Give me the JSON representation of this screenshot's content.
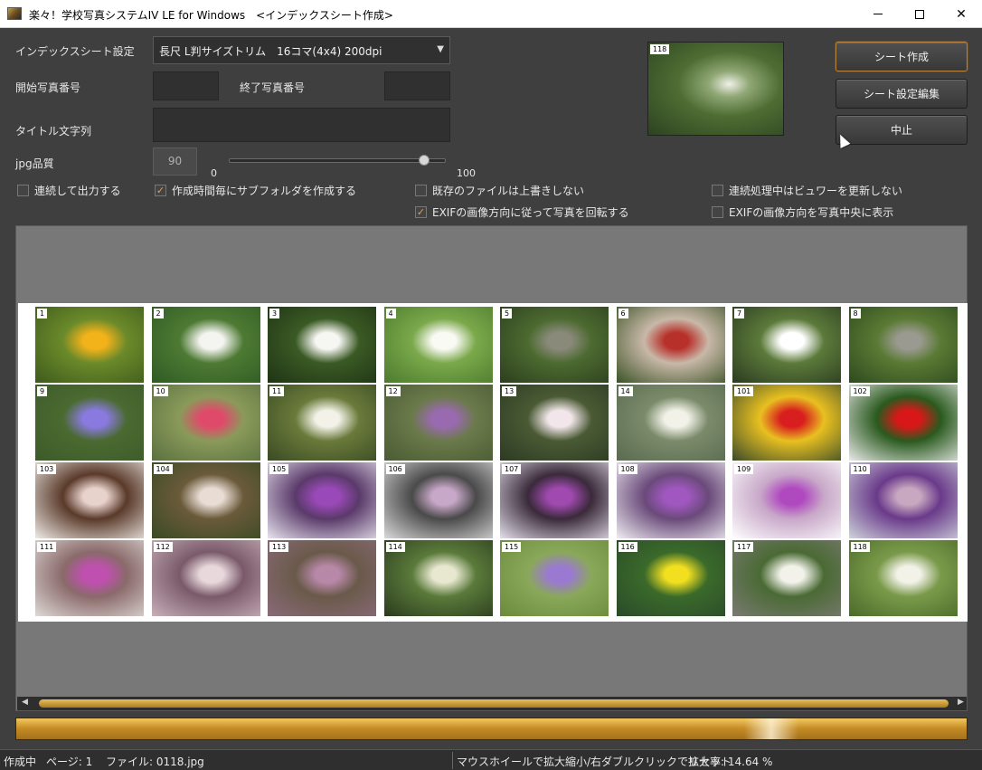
{
  "window": {
    "title": "楽々！学校写真システムIV LE for Windows　<インデックスシート作成>",
    "minimize": "—",
    "maximize": "□",
    "close": "✕"
  },
  "form": {
    "sheet_setting_label": "インデックスシート設定",
    "sheet_setting_value": "長尺 L判サイズトリム　16コマ(4x4) 200dpi",
    "start_photo_label": "開始写真番号",
    "end_photo_label": "終了写真番号",
    "start_photo_value": "",
    "end_photo_value": "",
    "title_label": "タイトル文字列",
    "title_value": "",
    "jpg_quality_label": "jpg品質",
    "jpg_quality_value": "90",
    "slider_min": "0",
    "slider_max": "100",
    "slider_value": 90
  },
  "checkboxes": [
    {
      "label": "連続して出力する",
      "checked": false
    },
    {
      "label": "作成時間毎にサブフォルダを作成する",
      "checked": true
    },
    {
      "label": "既存のファイルは上書きしない",
      "checked": false
    },
    {
      "label": "EXIFの画像方向に従って写真を回転する",
      "checked": true
    },
    {
      "label": "連続処理中はビュワーを更新しない",
      "checked": false
    },
    {
      "label": "EXIFの画像方向を写真中央に表示",
      "checked": false
    }
  ],
  "preview": {
    "number": "118"
  },
  "buttons": {
    "create_sheet": "シート作成",
    "edit_sheet_settings": "シート設定編集",
    "cancel": "中止"
  },
  "thumbnails": [
    {
      "number": "1",
      "colors": [
        "#3d5a1c",
        "#f2b21a",
        "#6b8a2a"
      ]
    },
    {
      "number": "2",
      "colors": [
        "#2f5a24",
        "#f4f4f0",
        "#4d7a33"
      ]
    },
    {
      "number": "3",
      "colors": [
        "#1f3315",
        "#f6f6f2",
        "#3a5a24"
      ]
    },
    {
      "number": "4",
      "colors": [
        "#4b7a2e",
        "#fafaf5",
        "#7aa84a"
      ]
    },
    {
      "number": "5",
      "colors": [
        "#2c3e1e",
        "#8a8a7a",
        "#4c6a30"
      ]
    },
    {
      "number": "6",
      "colors": [
        "#3a5226",
        "#b8302a",
        "#c8b8a8"
      ]
    },
    {
      "number": "7",
      "colors": [
        "#2a3a20",
        "#ffffff",
        "#5c7a3a"
      ]
    },
    {
      "number": "8",
      "colors": [
        "#2d4a1e",
        "#9a9a90",
        "#5a7a34"
      ]
    },
    {
      "number": "9",
      "colors": [
        "#3d5a2a",
        "#8a7ae0",
        "#4a6a30"
      ]
    },
    {
      "number": "10",
      "colors": [
        "#5a7040",
        "#e04a6a",
        "#8a9a5a"
      ]
    },
    {
      "number": "11",
      "colors": [
        "#3a4a24",
        "#f2f2e8",
        "#6a7a3a"
      ]
    },
    {
      "number": "12",
      "colors": [
        "#4a5a34",
        "#9a6ab0",
        "#6a7a4a"
      ]
    },
    {
      "number": "13",
      "colors": [
        "#2c3a22",
        "#f2e6ea",
        "#4a5a34"
      ]
    },
    {
      "number": "14",
      "colors": [
        "#5a6a50",
        "#f2f2e8",
        "#7a8a6a"
      ]
    },
    {
      "number": "101",
      "colors": [
        "#3a4a2a",
        "#d81e1e",
        "#e8c020"
      ]
    },
    {
      "number": "102",
      "colors": [
        "#eaeaea",
        "#d81818",
        "#2a5a1e"
      ]
    },
    {
      "number": "103",
      "colors": [
        "#f0ece8",
        "#e8d2cc",
        "#5a3a2a"
      ]
    },
    {
      "number": "104",
      "colors": [
        "#3a4a24",
        "#e8dcd4",
        "#6a5a3a"
      ]
    },
    {
      "number": "105",
      "colors": [
        "#e8e4ee",
        "#9a4ab8",
        "#5a3a6a"
      ]
    },
    {
      "number": "106",
      "colors": [
        "#dadada",
        "#c8a8c8",
        "#4a4a4a"
      ]
    },
    {
      "number": "107",
      "colors": [
        "#e4e0ea",
        "#a04ab0",
        "#3a2a3a"
      ]
    },
    {
      "number": "108",
      "colors": [
        "#f0eef2",
        "#a058c0",
        "#6a4a7a"
      ]
    },
    {
      "number": "109",
      "colors": [
        "#ffffff",
        "#b048c0",
        "#c8a8c8"
      ]
    },
    {
      "number": "110",
      "colors": [
        "#cfd4dc",
        "#c8a8c0",
        "#6a3a8a"
      ]
    },
    {
      "number": "111",
      "colors": [
        "#dedad6",
        "#c050b0",
        "#8a6a6a"
      ]
    },
    {
      "number": "112",
      "colors": [
        "#c8b0b8",
        "#e8d8dc",
        "#7a5a6a"
      ]
    },
    {
      "number": "113",
      "colors": [
        "#8a6a7a",
        "#b888a8",
        "#6a5a4a"
      ]
    },
    {
      "number": "114",
      "colors": [
        "#2a3a1e",
        "#e8e8d0",
        "#5a7a3a"
      ]
    },
    {
      "number": "115",
      "colors": [
        "#6a8a3a",
        "#9a7ad0",
        "#8aa85a"
      ]
    },
    {
      "number": "116",
      "colors": [
        "#2a4a2a",
        "#f2e020",
        "#3a6a2a"
      ]
    },
    {
      "number": "117",
      "colors": [
        "#7a7a72",
        "#f2f2ea",
        "#4a6a34"
      ]
    },
    {
      "number": "118",
      "colors": [
        "#4a6a2a",
        "#f2f2e8",
        "#7a9a4a"
      ]
    }
  ],
  "status": {
    "state": "作成中",
    "page": "ページ: 1",
    "file": "ファイル: 0118.jpg",
    "hint": "マウスホイールで拡大縮小/右ダブルクリックでリセット",
    "zoom": "拡大率: 14.64 %"
  },
  "progress": {
    "fraction": 1.0
  }
}
